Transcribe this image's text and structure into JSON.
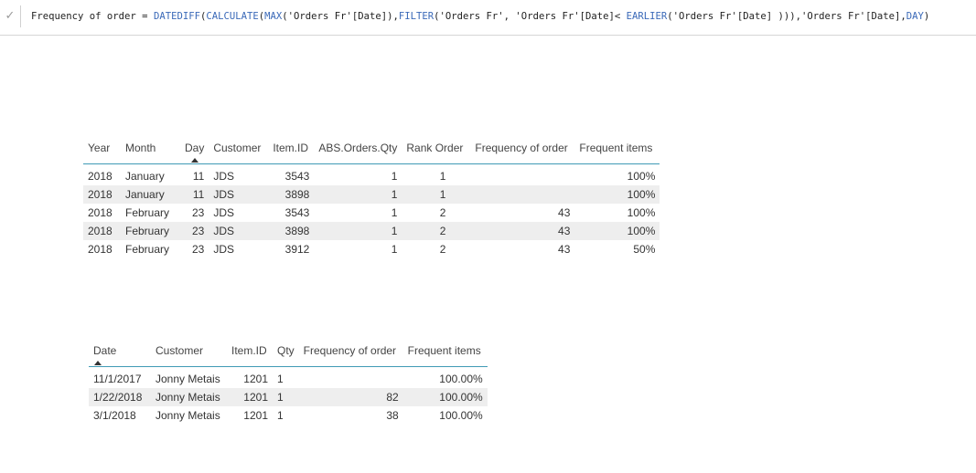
{
  "formula_bar": {
    "check_glyph": "✓",
    "parts": [
      {
        "text": "Frequency of order = ",
        "kind": "plain"
      },
      {
        "text": "DATEDIFF",
        "kind": "fn"
      },
      {
        "text": "(",
        "kind": "plain"
      },
      {
        "text": "CALCULATE",
        "kind": "fn"
      },
      {
        "text": "(",
        "kind": "plain"
      },
      {
        "text": "MAX",
        "kind": "fn"
      },
      {
        "text": "('Orders Fr'[Date]),",
        "kind": "plain"
      },
      {
        "text": "FILTER",
        "kind": "fn"
      },
      {
        "text": "('Orders Fr', 'Orders Fr'[Date]< ",
        "kind": "plain"
      },
      {
        "text": "EARLIER",
        "kind": "fn"
      },
      {
        "text": "('Orders Fr'[Date] ))),'Orders Fr'[Date],",
        "kind": "plain"
      },
      {
        "text": "DAY",
        "kind": "fn"
      },
      {
        "text": ")",
        "kind": "plain"
      }
    ]
  },
  "table1": {
    "headers": [
      "Year",
      "Month",
      "Day",
      "Customer",
      "Item.ID",
      "ABS.Orders.Qty",
      "Rank Order",
      "Frequency of order",
      "Frequent items"
    ],
    "sorted_column": "Day",
    "rows": [
      [
        "2018",
        "January",
        "11",
        "JDS",
        "3543",
        "1",
        "1",
        "",
        "100%"
      ],
      [
        "2018",
        "January",
        "11",
        "JDS",
        "3898",
        "1",
        "1",
        "",
        "100%"
      ],
      [
        "2018",
        "February",
        "23",
        "JDS",
        "3543",
        "1",
        "2",
        "43",
        "100%"
      ],
      [
        "2018",
        "February",
        "23",
        "JDS",
        "3898",
        "1",
        "2",
        "43",
        "100%"
      ],
      [
        "2018",
        "February",
        "23",
        "JDS",
        "3912",
        "1",
        "2",
        "43",
        "50%"
      ]
    ]
  },
  "table2": {
    "headers": [
      "Date",
      "Customer",
      "Item.ID",
      "Qty",
      "Frequency of order",
      "Frequent items"
    ],
    "sorted_column": "Date",
    "rows": [
      [
        "11/1/2017",
        "Jonny Metais",
        "1201",
        "1",
        "",
        "100.00%"
      ],
      [
        "1/22/2018",
        "Jonny Metais",
        "1201",
        "1",
        "82",
        "100.00%"
      ],
      [
        "3/1/2018",
        "Jonny Metais",
        "1201",
        "1",
        "38",
        "100.00%"
      ]
    ]
  },
  "colors": {
    "header_underline": "#3f9ab5",
    "alt_row": "#eeeeee",
    "function_blue": "#3a69b8"
  }
}
